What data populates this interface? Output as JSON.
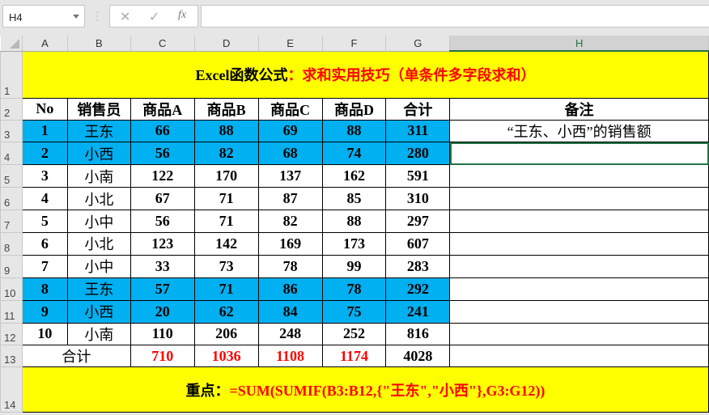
{
  "formula_bar": {
    "name_box": "H4",
    "cancel_icon": "✕",
    "enter_icon": "✓",
    "fx_label": "fx",
    "formula": ""
  },
  "columns": [
    "A",
    "B",
    "C",
    "D",
    "E",
    "F",
    "G",
    "H"
  ],
  "row_numbers": [
    "1",
    "2",
    "3",
    "4",
    "5",
    "6",
    "7",
    "8",
    "9",
    "10",
    "11",
    "12",
    "13",
    "14"
  ],
  "title": {
    "black": "Excel函数公式",
    "red": "：求和实用技巧（单条件多字段求和）"
  },
  "headers": [
    "No",
    "销售员",
    "商品A",
    "商品B",
    "商品C",
    "商品D",
    "合计",
    "备注"
  ],
  "rows": [
    {
      "no": "1",
      "name": "王东",
      "a": "66",
      "b": "88",
      "c": "69",
      "d": "88",
      "total": "311",
      "note": "“王东、小西”的销售额",
      "highlight": true
    },
    {
      "no": "2",
      "name": "小西",
      "a": "56",
      "b": "82",
      "c": "68",
      "d": "74",
      "total": "280",
      "note": "",
      "highlight": true
    },
    {
      "no": "3",
      "name": "小南",
      "a": "122",
      "b": "170",
      "c": "137",
      "d": "162",
      "total": "591",
      "note": "",
      "highlight": false
    },
    {
      "no": "4",
      "name": "小北",
      "a": "67",
      "b": "71",
      "c": "87",
      "d": "85",
      "total": "310",
      "note": "",
      "highlight": false
    },
    {
      "no": "5",
      "name": "小中",
      "a": "56",
      "b": "71",
      "c": "82",
      "d": "88",
      "total": "297",
      "note": "",
      "highlight": false
    },
    {
      "no": "6",
      "name": "小北",
      "a": "123",
      "b": "142",
      "c": "169",
      "d": "173",
      "total": "607",
      "note": "",
      "highlight": false
    },
    {
      "no": "7",
      "name": "小中",
      "a": "33",
      "b": "73",
      "c": "78",
      "d": "99",
      "total": "283",
      "note": "",
      "highlight": false
    },
    {
      "no": "8",
      "name": "王东",
      "a": "57",
      "b": "71",
      "c": "86",
      "d": "78",
      "total": "292",
      "note": "",
      "highlight": true
    },
    {
      "no": "9",
      "name": "小西",
      "a": "20",
      "b": "62",
      "c": "84",
      "d": "75",
      "total": "241",
      "note": "",
      "highlight": true
    },
    {
      "no": "10",
      "name": "小南",
      "a": "110",
      "b": "206",
      "c": "248",
      "d": "252",
      "total": "816",
      "note": "",
      "highlight": false
    }
  ],
  "totals": {
    "label": "合计",
    "a": "710",
    "b": "1036",
    "c": "1108",
    "d": "1174",
    "total": "4028"
  },
  "key_point": {
    "label": "重点：",
    "formula": "=SUM(SUMIF(B3:B12,{\"王东\",\"小西\"},G3:G12))"
  },
  "colors": {
    "yellow": "#ffff00",
    "blue": "#00b0f0",
    "red": "#ff0000",
    "selection": "#217346"
  }
}
